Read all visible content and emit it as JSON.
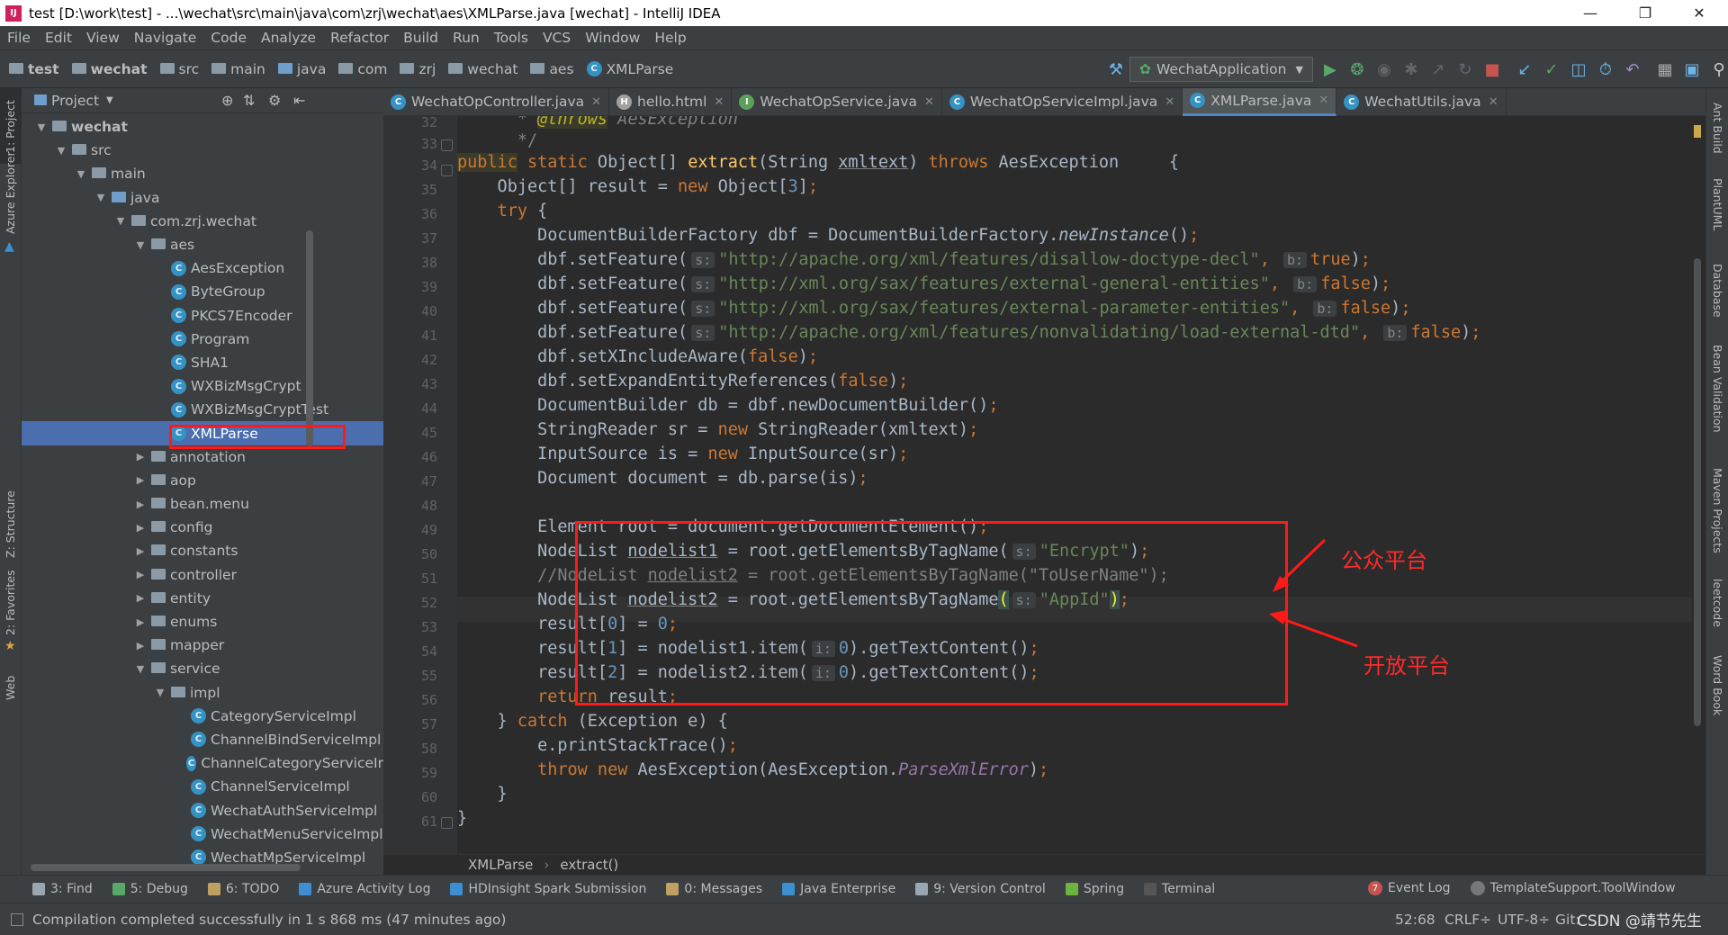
{
  "window": {
    "title": "test [D:\\work\\test] - ...\\wechat\\src\\main\\java\\com\\zrj\\wechat\\aes\\XMLParse.java [wechat] - IntelliJ IDEA"
  },
  "menu": [
    "File",
    "Edit",
    "View",
    "Navigate",
    "Code",
    "Analyze",
    "Refactor",
    "Build",
    "Run",
    "Tools",
    "VCS",
    "Window",
    "Help"
  ],
  "breadcrumbs": [
    "test",
    "wechat",
    "src",
    "main",
    "java",
    "com",
    "zrj",
    "wechat",
    "aes",
    "XMLParse"
  ],
  "run_config": "WechatApplication",
  "left_stripe": [
    "1: Project",
    "Azure Explorer",
    "Z: Structure",
    "2: Favorites",
    "Web"
  ],
  "right_stripe": [
    "Ant Build",
    "PlantUML",
    "Database",
    "Bean Validation",
    "Maven Projects",
    "leetcode",
    "Word Book"
  ],
  "project_panel": {
    "title": "Project",
    "tree": [
      {
        "label": "wechat",
        "depth": 0,
        "type": "folder",
        "open": true,
        "bold": true
      },
      {
        "label": "src",
        "depth": 1,
        "type": "folder",
        "open": true
      },
      {
        "label": "main",
        "depth": 2,
        "type": "folder",
        "open": true
      },
      {
        "label": "java",
        "depth": 3,
        "type": "folder",
        "open": true
      },
      {
        "label": "com.zrj.wechat",
        "depth": 4,
        "type": "package",
        "open": true
      },
      {
        "label": "aes",
        "depth": 5,
        "type": "package",
        "open": true
      },
      {
        "label": "AesException",
        "depth": 6,
        "type": "class"
      },
      {
        "label": "ByteGroup",
        "depth": 6,
        "type": "class"
      },
      {
        "label": "PKCS7Encoder",
        "depth": 6,
        "type": "class"
      },
      {
        "label": "Program",
        "depth": 6,
        "type": "class"
      },
      {
        "label": "SHA1",
        "depth": 6,
        "type": "class"
      },
      {
        "label": "WXBizMsgCrypt",
        "depth": 6,
        "type": "class"
      },
      {
        "label": "WXBizMsgCryptTest",
        "depth": 6,
        "type": "class"
      },
      {
        "label": "XMLParse",
        "depth": 6,
        "type": "class",
        "selected": true
      },
      {
        "label": "annotation",
        "depth": 5,
        "type": "package",
        "open": false
      },
      {
        "label": "aop",
        "depth": 5,
        "type": "package",
        "open": false
      },
      {
        "label": "bean.menu",
        "depth": 5,
        "type": "package",
        "open": false
      },
      {
        "label": "config",
        "depth": 5,
        "type": "package",
        "open": false
      },
      {
        "label": "constants",
        "depth": 5,
        "type": "package",
        "open": false
      },
      {
        "label": "controller",
        "depth": 5,
        "type": "package",
        "open": false
      },
      {
        "label": "entity",
        "depth": 5,
        "type": "package",
        "open": false
      },
      {
        "label": "enums",
        "depth": 5,
        "type": "package",
        "open": false
      },
      {
        "label": "mapper",
        "depth": 5,
        "type": "package",
        "open": false
      },
      {
        "label": "service",
        "depth": 5,
        "type": "package",
        "open": true
      },
      {
        "label": "impl",
        "depth": 6,
        "type": "package",
        "open": true
      },
      {
        "label": "CategoryServiceImpl",
        "depth": 7,
        "type": "class"
      },
      {
        "label": "ChannelBindServiceImpl",
        "depth": 7,
        "type": "class"
      },
      {
        "label": "ChannelCategoryServiceIr",
        "depth": 7,
        "type": "class"
      },
      {
        "label": "ChannelServiceImpl",
        "depth": 7,
        "type": "class"
      },
      {
        "label": "WechatAuthServiceImpl",
        "depth": 7,
        "type": "class"
      },
      {
        "label": "WechatMenuServiceImpl",
        "depth": 7,
        "type": "class"
      },
      {
        "label": "WechatMpServiceImpl",
        "depth": 7,
        "type": "class"
      }
    ]
  },
  "tabs": [
    {
      "label": "WechatOpController.java",
      "icon": "C",
      "color": "#3592c4"
    },
    {
      "label": "hello.html",
      "icon": "H",
      "color": "#a0a0a0"
    },
    {
      "label": "WechatOpService.java",
      "icon": "I",
      "color": "#5aa05a"
    },
    {
      "label": "WechatOpServiceImpl.java",
      "icon": "C",
      "color": "#3592c4"
    },
    {
      "label": "XMLParse.java",
      "icon": "C",
      "color": "#3592c4",
      "active": true
    },
    {
      "label": "WechatUtils.java",
      "icon": "C",
      "color": "#3592c4"
    }
  ],
  "line_numbers": [
    "32",
    "33",
    "34",
    "35",
    "36",
    "37",
    "38",
    "39",
    "40",
    "41",
    "42",
    "43",
    "44",
    "45",
    "46",
    "47",
    "48",
    "49",
    "50",
    "51",
    "52",
    "53",
    "54",
    "55",
    "56",
    "57",
    "58",
    "59",
    "60",
    "61"
  ],
  "editor_crumbs": [
    "XMLParse",
    "extract()"
  ],
  "annotations": {
    "box_label_top": "公众平台",
    "box_label_bottom": "开放平台"
  },
  "tool_windows": [
    {
      "label": "3: Find",
      "color": "#9aa7b0"
    },
    {
      "label": "5: Debug",
      "color": "#59a869"
    },
    {
      "label": "6: TODO",
      "color": "#c0a060"
    },
    {
      "label": "Azure Activity Log",
      "color": "#3d8fd1"
    },
    {
      "label": "HDInsight Spark Submission",
      "color": "#3d8fd1"
    },
    {
      "label": "0: Messages",
      "color": "#c0a060"
    },
    {
      "label": "Java Enterprise",
      "color": "#3d8fd1"
    },
    {
      "label": "9: Version Control",
      "color": "#9aa7b0"
    },
    {
      "label": "Spring",
      "color": "#6db33f"
    },
    {
      "label": "Terminal",
      "color": "#555555"
    }
  ],
  "tool_windows_right": [
    {
      "label": "Event Log",
      "badge": "7"
    },
    {
      "label": "TemplateSupport.ToolWindow"
    }
  ],
  "status": {
    "message": "Compilation completed successfully in 1 s 868 ms (47 minutes ago)",
    "position": "52:68",
    "line_sep": "CRLF÷",
    "encoding": "UTF-8÷",
    "vcs": "Git:",
    "watermark": "CSDN @靖节先生"
  }
}
